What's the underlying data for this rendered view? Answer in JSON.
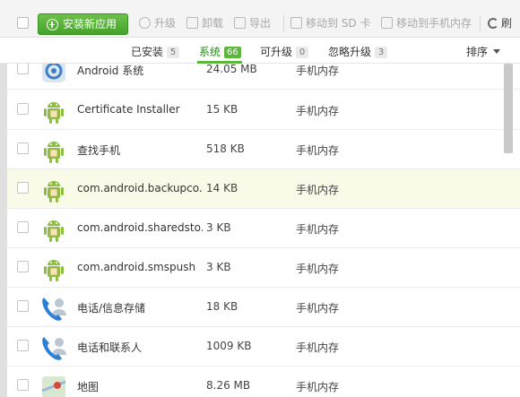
{
  "toolbar": {
    "install_label": "安装新应用",
    "upgrade_label": "升级",
    "uninstall_label": "卸载",
    "export_label": "导出",
    "move_sd_label": "移动到 SD 卡",
    "move_phone_label": "移动到手机内存",
    "refresh_label": "刷"
  },
  "tabs": [
    {
      "label": "已安装",
      "count": "5"
    },
    {
      "label": "系统",
      "count": "66"
    },
    {
      "label": "可升级",
      "count": "0"
    },
    {
      "label": "忽略升级",
      "count": "3"
    }
  ],
  "sort_label": "排序",
  "apps": [
    {
      "name": "Android 系统",
      "size": "24.05 MB",
      "location": "手机内存",
      "icon": "android-settings-icon"
    },
    {
      "name": "Certificate Installer",
      "size": "15 KB",
      "location": "手机内存",
      "icon": "android-robot-icon"
    },
    {
      "name": "查找手机",
      "size": "518 KB",
      "location": "手机内存",
      "icon": "android-robot-icon"
    },
    {
      "name": "com.android.backupco...",
      "size": "14 KB",
      "location": "手机内存",
      "icon": "android-robot-icon"
    },
    {
      "name": "com.android.sharedsto...",
      "size": "3 KB",
      "location": "手机内存",
      "icon": "android-robot-icon"
    },
    {
      "name": "com.android.smspush",
      "size": "3 KB",
      "location": "手机内存",
      "icon": "android-robot-icon"
    },
    {
      "name": "电话/信息存储",
      "size": "18 KB",
      "location": "手机内存",
      "icon": "phone-contacts-icon"
    },
    {
      "name": "电话和联系人",
      "size": "1009 KB",
      "location": "手机内存",
      "icon": "phone-contacts-icon"
    },
    {
      "name": "地图",
      "size": "8.26 MB",
      "location": "手机内存",
      "icon": "maps-icon"
    }
  ]
}
